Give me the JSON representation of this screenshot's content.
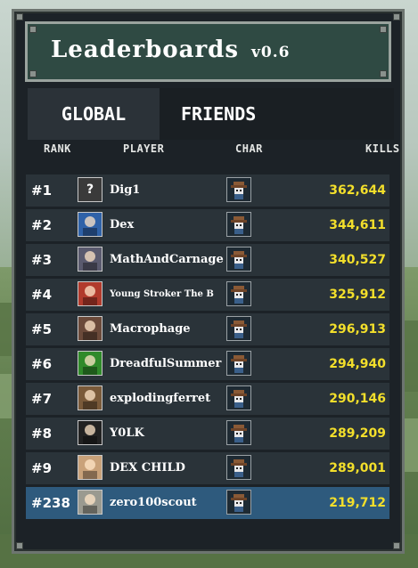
{
  "window": {
    "title": "Leaderboards",
    "version": "v0.6"
  },
  "tabs": [
    {
      "label": "GLOBAL",
      "active": true
    },
    {
      "label": "FRIENDS",
      "active": false
    }
  ],
  "columns": {
    "rank": "RANK",
    "player": "PLAYER",
    "char": "CHAR",
    "kills": "KILLS"
  },
  "rows": [
    {
      "rank": "#1",
      "player": "Dig1",
      "kills": "362,644",
      "avatar_icon": "question-mark-avatar-icon",
      "avatar_color": "#3a3a3a",
      "avatar_glyph": "?"
    },
    {
      "rank": "#2",
      "player": "Dex",
      "kills": "344,611",
      "avatar_icon": "cat-avatar-icon",
      "avatar_color": "#2f62a8",
      "avatar_glyph": ""
    },
    {
      "rank": "#3",
      "player": "MathAndCarnage",
      "kills": "340,527",
      "avatar_icon": "person-avatar-icon",
      "avatar_color": "#5a5a6e",
      "avatar_glyph": ""
    },
    {
      "rank": "#4",
      "player": "Young Stroker The B",
      "kills": "325,912",
      "avatar_icon": "clown-avatar-icon",
      "avatar_color": "#b13a2c",
      "avatar_glyph": ""
    },
    {
      "rank": "#5",
      "player": "Macrophage",
      "kills": "296,913",
      "avatar_icon": "person-avatar-icon",
      "avatar_color": "#6b4a3a",
      "avatar_glyph": ""
    },
    {
      "rank": "#6",
      "player": "DreadfulSummer",
      "kills": "294,940",
      "avatar_icon": "green-creature-avatar-icon",
      "avatar_color": "#2f8a2a",
      "avatar_glyph": ""
    },
    {
      "rank": "#7",
      "player": "explodingferret",
      "kills": "290,146",
      "avatar_icon": "animal-avatar-icon",
      "avatar_color": "#7a5a3a",
      "avatar_glyph": ""
    },
    {
      "rank": "#8",
      "player": "Y0LK",
      "kills": "289,209",
      "avatar_icon": "toilet-avatar-icon",
      "avatar_color": "#222222",
      "avatar_glyph": ""
    },
    {
      "rank": "#9",
      "player": "DEX CHILD",
      "kills": "289,001",
      "avatar_icon": "cat-avatar-icon",
      "avatar_color": "#c9a27a",
      "avatar_glyph": ""
    },
    {
      "rank": "#238",
      "player": "zero100scout",
      "kills": "219,712",
      "avatar_icon": "photo-avatar-icon",
      "avatar_color": "#9a9a90",
      "avatar_glyph": ""
    }
  ],
  "colors": {
    "kills": "#f3df2b",
    "highlight_row": "#2e5a7d",
    "header_bg": "#2f4a43"
  }
}
